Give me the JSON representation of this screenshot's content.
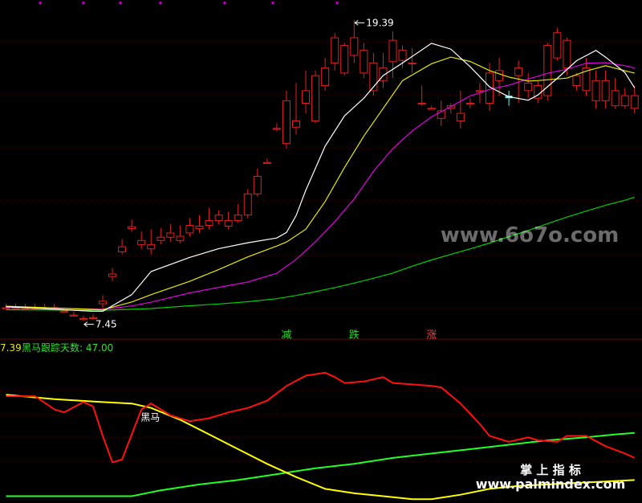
{
  "watermark_top": "www.6o7o.com",
  "watermark_bottom_cn": "掌 上 指 标",
  "watermark_bottom_url": "www.palmindex.com",
  "colors": {
    "background": "#000000",
    "grid": "#5a0000",
    "up": "#e02020",
    "down": "#54ffff",
    "ma5": "#ffffff",
    "ma10": "#e8e800",
    "ma20": "#e000e0",
    "ma60": "#00d000",
    "red_line": "#ff1010",
    "yellow_line": "#ffff00",
    "green_line": "#22ff22",
    "label_text": "#ffffff"
  },
  "chart_data": [
    {
      "type": "candlestick",
      "ylim": [
        6.8,
        20.2
      ],
      "price_high_label": "19.39",
      "price_low_label": "7.45",
      "markers": [
        {
          "index": 29,
          "text": "减",
          "color": "#30d030"
        },
        {
          "index": 36,
          "text": "跌",
          "color": "#30d030"
        },
        {
          "index": 44,
          "text": "涨",
          "color": "#ff4040"
        }
      ],
      "candles": [
        [
          7.96,
          7.96,
          7.98,
          8.14
        ],
        [
          7.96,
          7.96,
          7.98,
          8.14
        ],
        [
          7.96,
          7.96,
          7.98,
          8.14
        ],
        [
          7.96,
          7.96,
          7.98,
          8.14
        ],
        [
          7.96,
          7.96,
          7.98,
          8.14
        ],
        [
          7.96,
          7.96,
          7.98,
          8.14
        ],
        [
          7.83,
          7.81,
          7.85,
          7.99
        ],
        [
          7.67,
          7.65,
          7.69,
          7.83
        ],
        [
          7.51,
          7.45,
          7.55,
          7.67
        ],
        [
          7.57,
          7.51,
          7.59,
          7.73
        ],
        [
          8.14,
          7.96,
          8.24,
          8.48
        ],
        [
          9.22,
          9.04,
          9.32,
          9.56
        ],
        [
          10.2,
          10.1,
          10.4,
          10.7
        ],
        [
          11.12,
          11.0,
          11.2,
          11.48
        ],
        [
          10.49,
          10.3,
          10.65,
          11.0
        ],
        [
          10.32,
          10.1,
          10.49,
          11.1
        ],
        [
          10.65,
          10.5,
          10.78,
          11.15
        ],
        [
          10.78,
          10.6,
          10.95,
          11.3
        ],
        [
          10.65,
          10.55,
          10.82,
          11.25
        ],
        [
          10.95,
          10.8,
          11.25,
          11.55
        ],
        [
          11.12,
          10.95,
          11.22,
          11.65
        ],
        [
          11.25,
          11.1,
          11.44,
          11.95
        ],
        [
          11.44,
          11.3,
          11.66,
          11.85
        ],
        [
          11.22,
          11.1,
          11.44,
          11.8
        ],
        [
          11.44,
          11.35,
          11.66,
          12.1
        ],
        [
          11.66,
          11.55,
          12.5,
          12.7
        ],
        [
          12.5,
          12.4,
          13.2,
          13.5
        ],
        [
          13.75,
          13.7,
          13.75,
          13.9
        ],
        [
          15.1,
          15.0,
          15.1,
          15.3
        ],
        [
          14.5,
          14.3,
          16.2,
          16.6
        ],
        [
          15.15,
          14.85,
          15.4,
          16.9
        ],
        [
          16.1,
          15.7,
          16.6,
          17.4
        ],
        [
          15.4,
          15.3,
          17.2,
          17.4
        ],
        [
          16.8,
          16.6,
          17.5,
          17.9
        ],
        [
          17.7,
          17.4,
          18.7,
          18.9
        ],
        [
          17.3,
          17.2,
          18.4,
          18.5
        ],
        [
          18.0,
          17.7,
          18.7,
          19.39
        ],
        [
          17.3,
          17.1,
          18.2,
          18.5
        ],
        [
          16.6,
          16.4,
          17.7,
          18.1
        ],
        [
          17.0,
          16.7,
          17.5,
          18.1
        ],
        [
          17.75,
          17.1,
          18.6,
          18.95
        ],
        [
          17.8,
          17.5,
          18.2,
          18.4
        ],
        [
          17.7,
          17.3,
          17.7,
          18.3
        ],
        [
          16.1,
          16.0,
          16.1,
          16.8
        ],
        [
          15.9,
          15.9,
          15.9,
          16.0
        ],
        [
          15.5,
          15.2,
          15.8,
          16.2
        ],
        [
          15.9,
          15.7,
          16.0,
          16.1
        ],
        [
          15.4,
          15.1,
          15.7,
          16.6
        ],
        [
          16.1,
          15.9,
          16.1,
          16.3
        ],
        [
          16.6,
          16.1,
          16.6,
          16.9
        ],
        [
          16.1,
          15.8,
          17.3,
          17.7
        ],
        [
          17.0,
          16.4,
          17.4,
          17.9
        ],
        [
          16.4,
          16.0,
          16.3,
          16.6
        ],
        [
          17.2,
          16.1,
          17.5,
          17.8
        ],
        [
          16.6,
          16.3,
          16.9,
          17.3
        ],
        [
          16.3,
          16.1,
          16.8,
          17.0
        ],
        [
          16.4,
          16.2,
          18.4,
          18.5
        ],
        [
          17.9,
          17.8,
          18.9,
          19.1
        ],
        [
          17.5,
          17.2,
          18.6,
          18.7
        ],
        [
          16.8,
          16.6,
          17.2,
          17.3
        ],
        [
          16.6,
          16.4,
          17.5,
          17.9
        ],
        [
          16.2,
          15.9,
          17.0,
          17.4
        ],
        [
          16.2,
          15.9,
          17.0,
          17.4
        ],
        [
          16.0,
          15.9,
          16.6,
          17.1
        ],
        [
          16.0,
          15.9,
          16.4,
          16.7
        ],
        [
          15.9,
          15.7,
          16.4,
          16.8
        ]
      ],
      "ma5": [
        [
          0,
          8.02
        ],
        [
          9,
          7.84
        ],
        [
          10,
          7.84
        ],
        [
          13,
          8.5
        ],
        [
          15,
          9.42
        ],
        [
          19,
          9.98
        ],
        [
          22,
          10.33
        ],
        [
          25,
          10.56
        ],
        [
          28,
          10.75
        ],
        [
          29,
          10.97
        ],
        [
          30,
          11.64
        ],
        [
          31,
          12.65
        ],
        [
          33,
          14.4
        ],
        [
          35,
          15.6
        ],
        [
          37,
          16.3
        ],
        [
          39,
          17.2
        ],
        [
          41,
          17.7
        ],
        [
          44,
          18.48
        ],
        [
          46,
          18.25
        ],
        [
          48,
          17.55
        ],
        [
          50,
          16.75
        ],
        [
          52,
          16.36
        ],
        [
          54,
          16.22
        ],
        [
          55,
          16.43
        ],
        [
          57,
          17.09
        ],
        [
          59,
          17.79
        ],
        [
          61,
          18.2
        ],
        [
          62,
          17.93
        ],
        [
          64,
          17.32
        ],
        [
          65,
          16.71
        ]
      ],
      "ma10": [
        [
          0,
          8.04
        ],
        [
          10,
          7.9
        ],
        [
          13,
          8.21
        ],
        [
          15,
          8.5
        ],
        [
          19,
          9.03
        ],
        [
          22,
          9.5
        ],
        [
          25,
          10.0
        ],
        [
          28,
          10.43
        ],
        [
          29,
          10.59
        ],
        [
          31,
          11.1
        ],
        [
          33,
          12.2
        ],
        [
          35,
          13.55
        ],
        [
          37,
          14.8
        ],
        [
          39,
          15.9
        ],
        [
          41,
          17.0
        ],
        [
          44,
          17.67
        ],
        [
          46,
          17.93
        ],
        [
          48,
          17.76
        ],
        [
          50,
          17.4
        ],
        [
          52,
          17.14
        ],
        [
          54,
          16.98
        ],
        [
          55,
          17.0
        ],
        [
          58,
          17.1
        ],
        [
          60,
          17.38
        ],
        [
          62,
          17.59
        ],
        [
          64,
          17.39
        ],
        [
          65,
          17.3
        ]
      ],
      "ma20": [
        [
          0,
          8.0
        ],
        [
          10,
          7.92
        ],
        [
          13,
          8.05
        ],
        [
          15,
          8.2
        ],
        [
          19,
          8.57
        ],
        [
          22,
          8.79
        ],
        [
          25,
          9.0
        ],
        [
          28,
          9.35
        ],
        [
          30,
          9.9
        ],
        [
          32,
          10.6
        ],
        [
          34,
          11.4
        ],
        [
          36,
          12.3
        ],
        [
          38,
          13.4
        ],
        [
          40,
          14.3
        ],
        [
          42,
          15.0
        ],
        [
          44,
          15.56
        ],
        [
          46,
          15.97
        ],
        [
          48,
          16.39
        ],
        [
          50,
          16.65
        ],
        [
          52,
          16.82
        ],
        [
          54,
          17.06
        ],
        [
          56,
          17.29
        ],
        [
          58,
          17.45
        ],
        [
          60,
          17.69
        ],
        [
          62,
          17.71
        ],
        [
          64,
          17.59
        ],
        [
          65,
          17.5
        ]
      ],
      "ma60": [
        [
          0,
          7.9
        ],
        [
          10,
          7.88
        ],
        [
          13,
          7.92
        ],
        [
          15,
          7.95
        ],
        [
          19,
          8.06
        ],
        [
          22,
          8.13
        ],
        [
          25,
          8.22
        ],
        [
          28,
          8.34
        ],
        [
          30,
          8.47
        ],
        [
          32,
          8.62
        ],
        [
          34,
          8.78
        ],
        [
          36,
          8.96
        ],
        [
          38,
          9.15
        ],
        [
          40,
          9.36
        ],
        [
          42,
          9.63
        ],
        [
          44,
          9.88
        ],
        [
          46,
          10.1
        ],
        [
          48,
          10.32
        ],
        [
          50,
          10.55
        ],
        [
          52,
          10.8
        ],
        [
          54,
          11.05
        ],
        [
          56,
          11.32
        ],
        [
          58,
          11.58
        ],
        [
          60,
          11.82
        ],
        [
          62,
          12.05
        ],
        [
          64,
          12.25
        ],
        [
          65,
          12.37
        ]
      ]
    },
    {
      "type": "line",
      "header_value": "7.39",
      "header_label": "黑马跟踪天数: 47.00",
      "point_label": "黑马",
      "point_label_index": 14,
      "ylim": [
        0,
        100
      ],
      "red": [
        [
          0,
          71
        ],
        [
          3,
          71
        ],
        [
          5,
          62
        ],
        [
          6,
          60
        ],
        [
          8,
          67
        ],
        [
          9,
          64
        ],
        [
          10,
          44
        ],
        [
          11,
          26
        ],
        [
          12,
          28
        ],
        [
          13,
          45
        ],
        [
          14,
          62
        ],
        [
          15,
          66
        ],
        [
          17,
          58
        ],
        [
          19,
          54
        ],
        [
          21,
          56
        ],
        [
          23,
          60
        ],
        [
          25,
          63
        ],
        [
          27,
          68
        ],
        [
          29,
          78
        ],
        [
          31,
          85
        ],
        [
          33,
          87
        ],
        [
          34,
          84
        ],
        [
          35,
          80
        ],
        [
          37,
          81
        ],
        [
          39,
          84
        ],
        [
          40,
          80
        ],
        [
          42,
          79
        ],
        [
          44,
          78
        ],
        [
          45,
          77
        ],
        [
          47,
          66
        ],
        [
          49,
          52
        ],
        [
          50,
          44
        ],
        [
          52,
          40
        ],
        [
          54,
          43
        ],
        [
          55,
          41
        ],
        [
          57,
          40
        ],
        [
          58,
          44
        ],
        [
          60,
          44
        ],
        [
          62,
          37
        ],
        [
          64,
          32
        ],
        [
          65,
          29
        ]
      ],
      "yellow": [
        [
          0,
          72
        ],
        [
          5,
          69
        ],
        [
          10,
          67
        ],
        [
          13,
          66
        ],
        [
          15,
          63
        ],
        [
          18,
          55
        ],
        [
          21,
          45
        ],
        [
          24,
          35
        ],
        [
          27,
          25
        ],
        [
          30,
          16
        ],
        [
          33,
          8
        ],
        [
          36,
          5
        ],
        [
          39,
          3
        ],
        [
          42,
          1
        ],
        [
          44,
          1
        ],
        [
          47,
          4
        ],
        [
          50,
          8
        ],
        [
          53,
          10
        ],
        [
          56,
          11
        ],
        [
          59,
          12
        ],
        [
          62,
          13
        ],
        [
          65,
          14
        ]
      ],
      "green": [
        [
          0,
          3
        ],
        [
          13,
          3
        ],
        [
          16,
          7
        ],
        [
          20,
          11
        ],
        [
          24,
          14
        ],
        [
          28,
          18
        ],
        [
          32,
          22
        ],
        [
          36,
          25
        ],
        [
          40,
          29
        ],
        [
          44,
          32
        ],
        [
          48,
          35
        ],
        [
          52,
          38
        ],
        [
          56,
          41
        ],
        [
          60,
          43
        ],
        [
          63,
          45
        ],
        [
          65,
          46
        ]
      ]
    }
  ]
}
